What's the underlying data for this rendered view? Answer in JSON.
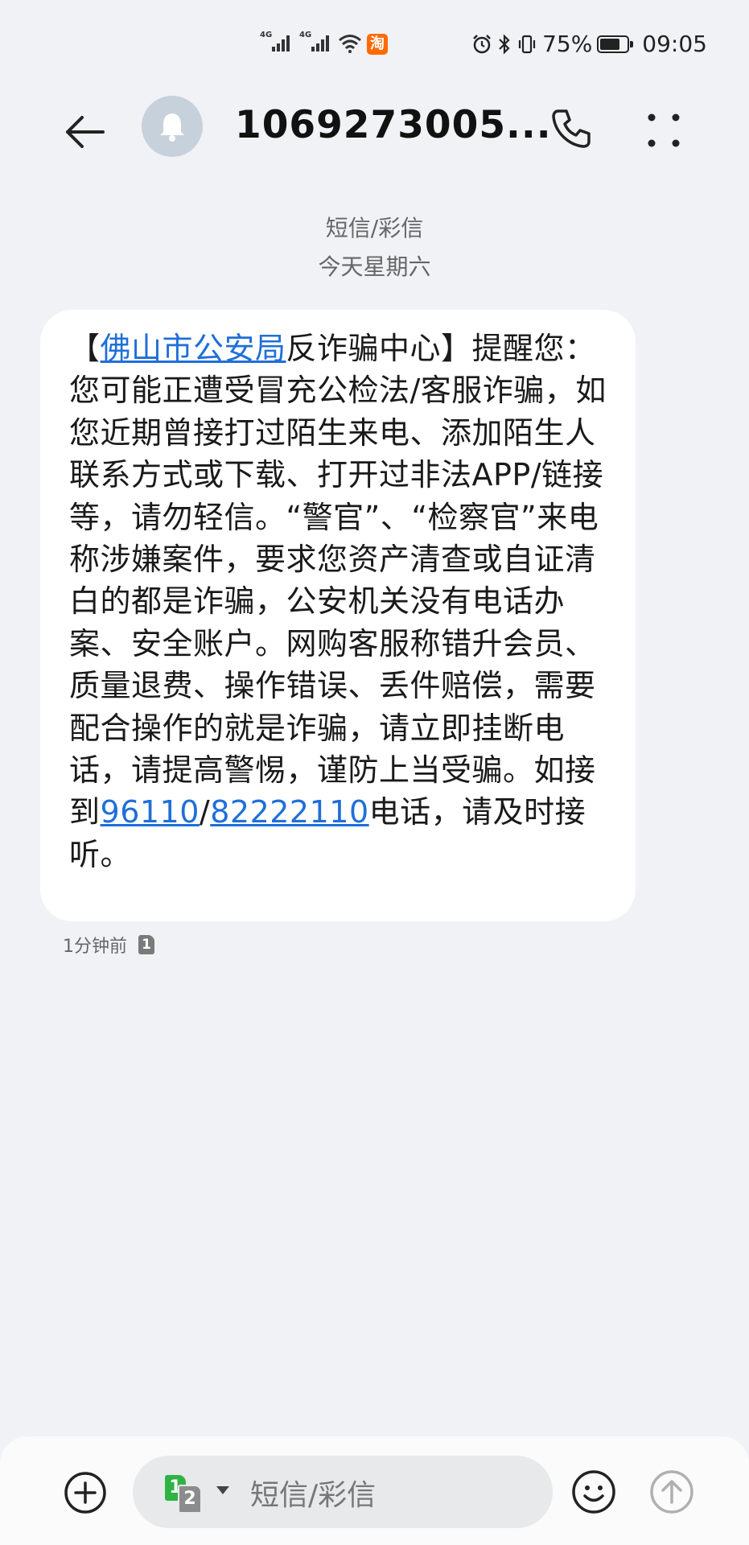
{
  "status_bar": {
    "sim1_network": "4G",
    "sim2_network": "4G",
    "battery": "75%",
    "battery_level": 0.75,
    "time": "09:05",
    "icons": [
      "signal-icon",
      "wifi-icon",
      "taobao-icon",
      "alarm-icon",
      "bluetooth-icon",
      "vibrate-icon",
      "battery-icon"
    ],
    "taobao_label": "淘"
  },
  "header": {
    "contact": "1069273005...",
    "icons": [
      "back-arrow-icon",
      "bell-icon",
      "phone-icon",
      "more-vertical-icon"
    ]
  },
  "thread": {
    "message_type": "短信/彩信",
    "date_label": "今天星期六"
  },
  "message": {
    "segments": [
      {
        "text": "【",
        "link": false
      },
      {
        "text": "佛山市公安局",
        "link": true
      },
      {
        "text": "反诈骗中心】提醒您：您可能正遭受冒充公检法/客服诈骗，如您近期曾接打过陌生来电、添加陌生人联系方式或下载、打开过非法APP/链接等，请勿轻信。“警官”、“检察官”来电称涉嫌案件，要求您资产清查或自证清白的都是诈骗，公安机关没有电话办案、安全账户。网购客服称错升会员、质量退费、操作错误、丢件赔偿，需要配合操作的就是诈骗，请立即挂断电话，请提高警惕，谨防上当受骗。如接到",
        "link": false
      },
      {
        "text": "96110",
        "link": true
      },
      {
        "text": "/",
        "link": false
      },
      {
        "text": "82222110",
        "link": true
      },
      {
        "text": "电话，请及时接听。",
        "link": false
      }
    ],
    "time_ago": "1分钟前",
    "sim_slot": "1"
  },
  "composer": {
    "placeholder": "短信/彩信",
    "sim_primary": "1",
    "sim_secondary": "2",
    "icons": [
      "add-icon",
      "emoji-icon",
      "send-icon",
      "dropdown-caret-icon"
    ],
    "colors": {
      "sim1": "#2fb345",
      "link": "#1f6fd9"
    }
  }
}
